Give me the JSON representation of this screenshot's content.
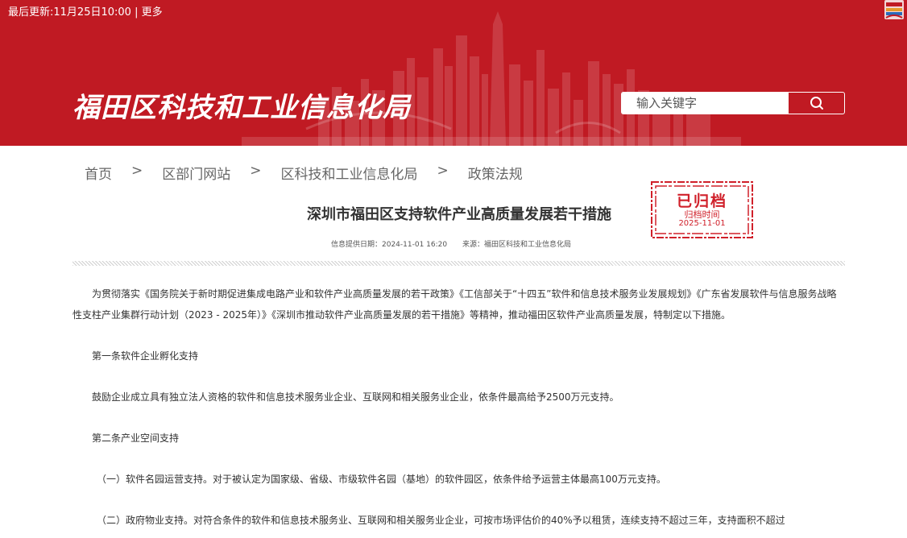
{
  "topbar": {
    "last_updated": "最后更新:11月25日10:00",
    "separator": "|",
    "more": "更多"
  },
  "site": {
    "title": "福田区科技和工业信息化局"
  },
  "search": {
    "placeholder": "输入关键字"
  },
  "breadcrumb": {
    "items": [
      "首页",
      "区部门网站",
      "区科技和工业信息化局",
      "政策法规"
    ],
    "separator": ">"
  },
  "article": {
    "title": "深圳市福田区支持软件产业高质量发展若干措施",
    "meta_date": "信息提供日期：2024-11-01 16:20",
    "meta_source": "来源：福田区科技和工业信息化局"
  },
  "stamp": {
    "label": "已归档",
    "sub": "归档时间",
    "date": "2025-11-01"
  },
  "content": {
    "intro": "为贯彻落实《国务院关于新时期促进集成电路产业和软件产业高质量发展的若干政策》《工信部关于“十四五”软件和信息技术服务业发展规划》《广东省发展软件与信息服务战略性支柱产业集群行动计划（2023 - 2025年）》《深圳市推动软件产业高质量发展的若干措施》等精神，推动福田区软件产业高质量发展，特制定以下措施。",
    "art1_heading": "第一条软件企业孵化支持",
    "art1_text": "鼓励企业成立具有独立法人资格的软件和信息技术服务业企业、互联网和相关服务业企业，依条件最高给予2500万元支持。",
    "art2_heading": "第二条产业空间支持",
    "art2_item1": "（一）软件名园运营支持。对于被认定为国家级、省级、市级软件名园（基地）的软件园区，依条件给予运营主体最高100万元支持。",
    "art2_item2": "（二）政府物业支持。对符合条件的软件和信息技术服务业、互联网和相关服务业企业，可按市场评估价的40%予以租赁，连续支持不超过三年，支持面积不超过"
  },
  "colors": {
    "brand_red": "#c01a23",
    "stamp_red": "#d0202a"
  },
  "icons": {
    "search": "magnifier-icon",
    "emblem": "emblem-icon"
  }
}
